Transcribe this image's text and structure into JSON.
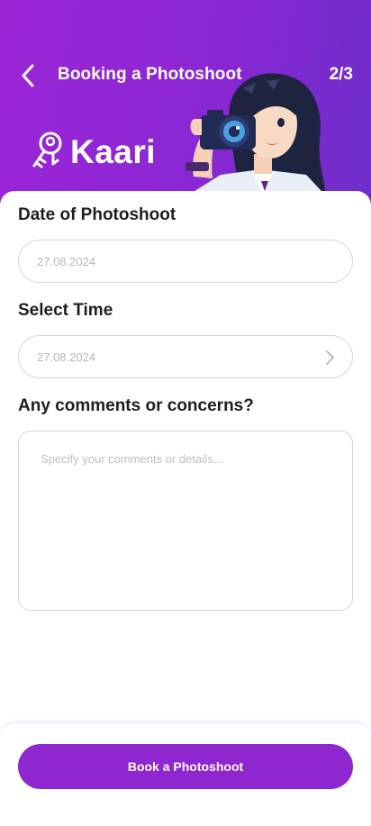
{
  "header": {
    "title": "Booking a Photoshoot",
    "step": "2/3",
    "brand": "Kaari"
  },
  "form": {
    "date": {
      "label": "Date of Photoshoot",
      "value": "27.08.2024"
    },
    "time": {
      "label": "Select Time",
      "value": "27.08.2024"
    },
    "comments": {
      "label": "Any comments or concerns?",
      "placeholder": "Specify your comments or details..."
    }
  },
  "footer": {
    "button_label": "Book a Photoshoot"
  },
  "colors": {
    "primary": "#8e27cf",
    "header_gradient_start": "#9b26d6",
    "header_gradient_end": "#6d2ec9"
  },
  "icons": [
    "back-arrow-icon",
    "chevron-right-icon",
    "kaari-logo-icon"
  ]
}
